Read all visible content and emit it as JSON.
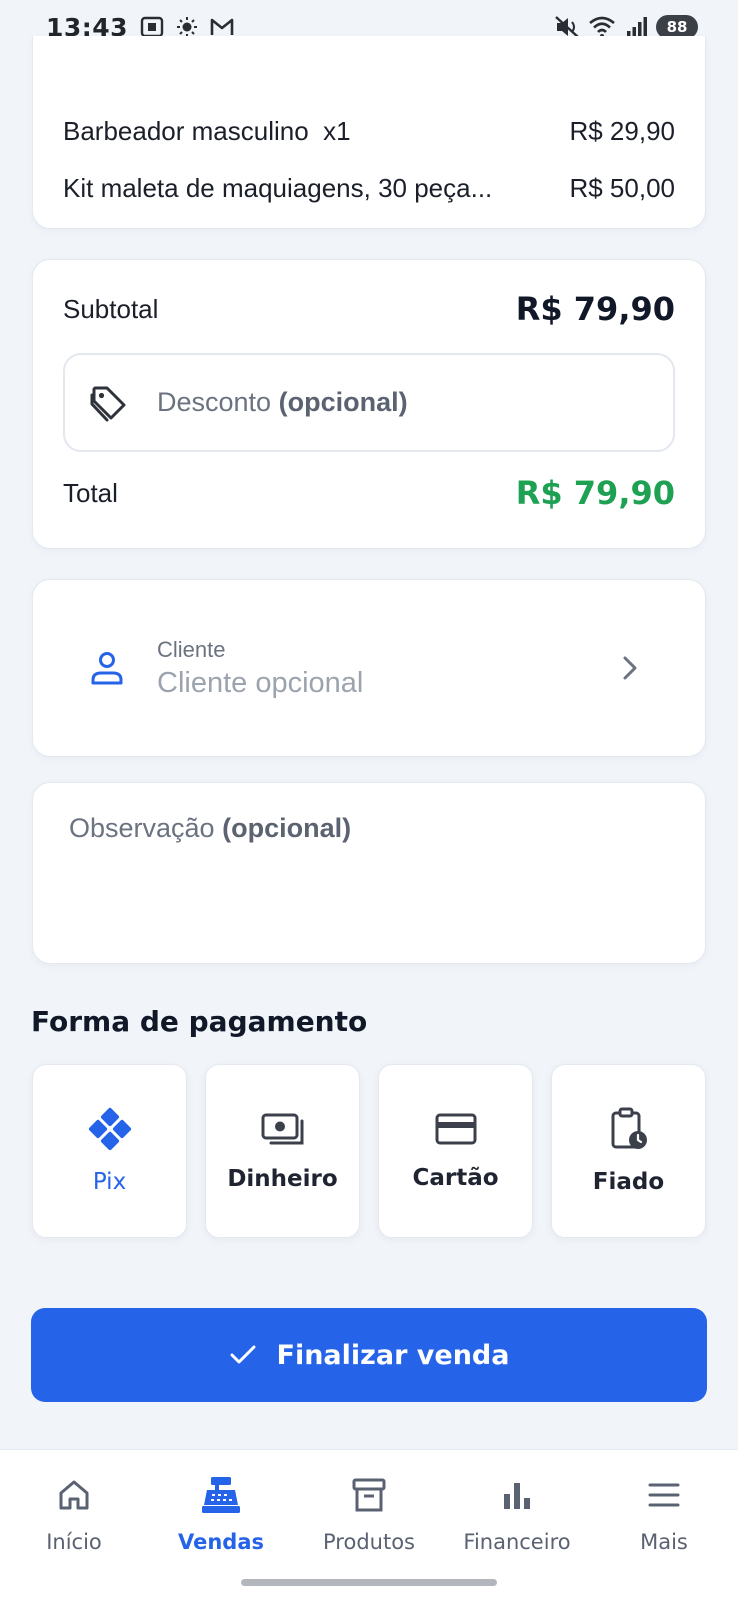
{
  "status_bar": {
    "time": "13:43",
    "battery": "88",
    "left_icons": [
      "screenshot-icon",
      "brightness-icon",
      "gmail-icon"
    ],
    "right_icons": [
      "mute-icon",
      "wifi-icon",
      "signal-icon"
    ]
  },
  "order_items": [
    {
      "name": "Barbeador masculino  x1",
      "price": "R$ 29,90"
    },
    {
      "name": "Kit maleta de maquiagens, 30 peça...",
      "price": "R$ 50,00"
    }
  ],
  "totals": {
    "subtotal_label": "Subtotal",
    "subtotal_value": "R$ 79,90",
    "discount_placeholder": "Desconto",
    "discount_optional": "(opcional)",
    "total_label": "Total",
    "total_value": "R$ 79,90",
    "total_color": "#1ea152"
  },
  "client": {
    "label": "Cliente",
    "placeholder": "Cliente opcional"
  },
  "note": {
    "placeholder": "Observação",
    "optional": "(opcional)"
  },
  "payment": {
    "title": "Forma de pagamento",
    "options": [
      {
        "label": "Pix",
        "icon": "pix-icon",
        "selected": true
      },
      {
        "label": "Dinheiro",
        "icon": "cash-icon",
        "selected": false
      },
      {
        "label": "Cartão",
        "icon": "card-icon",
        "selected": false
      },
      {
        "label": "Fiado",
        "icon": "clipboard-clock-icon",
        "selected": false
      }
    ]
  },
  "finish_button": {
    "label": "Finalizar venda",
    "color": "#2563e8"
  },
  "nav": {
    "items": [
      {
        "label": "Início",
        "icon": "home-icon",
        "active": false
      },
      {
        "label": "Vendas",
        "icon": "cash-register-icon",
        "active": true
      },
      {
        "label": "Produtos",
        "icon": "archive-icon",
        "active": false
      },
      {
        "label": "Financeiro",
        "icon": "bar-chart-icon",
        "active": false
      },
      {
        "label": "Mais",
        "icon": "menu-icon",
        "active": false
      }
    ]
  }
}
